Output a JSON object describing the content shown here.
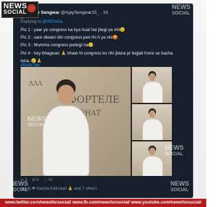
{
  "tweet": {
    "author_name": "Ajay Sengwar",
    "author_handle": "@AjaySengwar15_ · 1h",
    "replying_prefix": "Replying to",
    "replying_handle": "@INCIndia",
    "lines": [
      "Pic 1 : yaar ye congress ka kya hual hai jitegi ya nhi😟",
      "Pic 2 : sare diwaro bhi congress jeet rhi h ya nhi😡",
      "Pic 3 : Mumma congress jeetegi na😢",
      "Pic 4 : hey bhagwan 🙏 bhale hi congress ko nhi jitana pr bejjati hone se bacha",
      "lena..😢🙏"
    ],
    "hashtag": "#BottoTag",
    "graffiti": [
      "ФОРТЕЛЕ",
      "ЗЕНАТ",
      "ΛΛΛ"
    ],
    "footer_actions": [
      "↩ 3",
      "⇄ 6",
      "♡ 12"
    ],
    "likes_text": "Anjali ❤ Aasrita Katmaan 🙏 and 7 others"
  },
  "watermark": {
    "brand_top": "NEWS",
    "brand_bottom": "SOCIAL"
  },
  "footer_bar": {
    "text": "www.twitter.com/newsforsocial/  www.fb.com/newsforsocial/  www.youtube.com/newsforsocial/"
  },
  "colors": {
    "tweet_bg": "#16202b",
    "link": "#1da1f2",
    "footer_bg": "#b71c1c"
  }
}
